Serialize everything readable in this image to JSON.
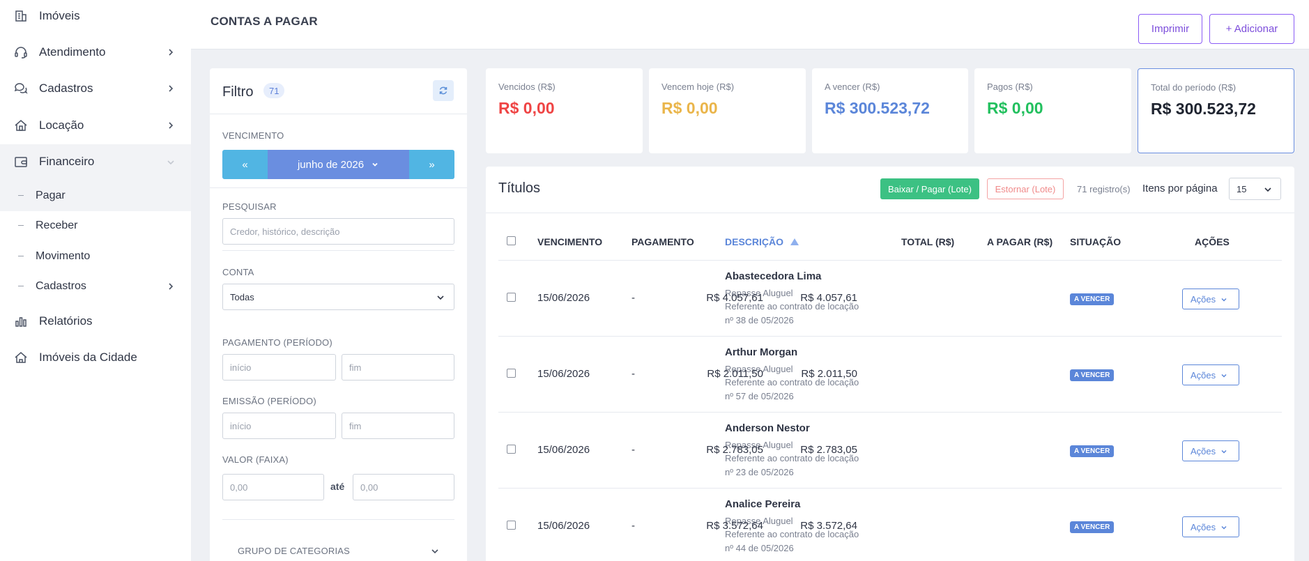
{
  "sidebar": {
    "items": [
      {
        "label": "Imóveis",
        "icon": "building-icon",
        "chevron": false
      },
      {
        "label": "Atendimento",
        "icon": "headset-icon",
        "chevron": true
      },
      {
        "label": "Cadastros",
        "icon": "chat-icon",
        "chevron": true
      },
      {
        "label": "Locação",
        "icon": "house-icon",
        "chevron": true
      },
      {
        "label": "Financeiro",
        "icon": "wallet-icon",
        "chevron": true,
        "expanded": true
      }
    ],
    "sub_items": [
      {
        "label": "Pagar",
        "active": true
      },
      {
        "label": "Receber"
      },
      {
        "label": "Movimento"
      },
      {
        "label": "Cadastros",
        "chevron": true
      }
    ],
    "bottom_items": [
      {
        "label": "Relatórios",
        "icon": "bar-chart-icon"
      },
      {
        "label": "Imóveis da Cidade",
        "icon": "house-outline-icon"
      }
    ]
  },
  "header": {
    "title": "CONTAS A PAGAR",
    "print_label": "Imprimir",
    "add_label": "+ Adicionar"
  },
  "filter": {
    "title": "Filtro",
    "count": "71",
    "vencimento_label": "VENCIMENTO",
    "prev_label": "«",
    "month_label": "junho de 2026",
    "next_label": "»",
    "search_label": "PESQUISAR",
    "search_placeholder": "Credor, histórico, descrição",
    "conta_label": "CONTA",
    "conta_value": "Todas",
    "pagamento_label": "PAGAMENTO (PERÍODO)",
    "emissao_label": "EMISSÃO (PERÍODO)",
    "inicio_placeholder": "início",
    "fim_placeholder": "fim",
    "valor_label": "VALOR (FAIXA)",
    "valor_min": "0,00",
    "valor_max": "0,00",
    "ate_label": "até",
    "grupo_label": "GRUPO DE CATEGORIAS"
  },
  "stats": [
    {
      "label": "Vencidos (R$)",
      "value": "R$ 0,00",
      "color": "#ef4444"
    },
    {
      "label": "Vencem hoje (R$)",
      "value": "R$ 0,00",
      "color": "#eab54a"
    },
    {
      "label": "A vencer (R$)",
      "value": "R$ 300.523,72",
      "color": "#5b86d9"
    },
    {
      "label": "Pagos (R$)",
      "value": "R$ 0,00",
      "color": "#22c05e"
    },
    {
      "label": "Total do período (R$)",
      "value": "R$ 300.523,72",
      "color": "#1f2430"
    }
  ],
  "titles": {
    "heading": "Títulos",
    "batch_pay_label": "Baixar / Pagar (Lote)",
    "batch_reverse_label": "Estornar (Lote)",
    "records_label": "71 registro(s)",
    "per_page_label": "Itens por página",
    "per_page_value": "15",
    "columns": {
      "vencimento": "VENCIMENTO",
      "pagamento": "PAGAMENTO",
      "descricao": "DESCRIÇÃO",
      "total": "TOTAL (R$)",
      "a_pagar": "A PAGAR (R$)",
      "situacao": "SITUAÇÃO",
      "acoes": "AÇÕES"
    },
    "rows": [
      {
        "vencimento": "15/06/2026",
        "pagamento": "-",
        "name": "Abastecedora Lima",
        "line1": "Repasse Aluguel",
        "line2": "Referente ao contrato de locação",
        "line3": "nº 38 de 05/2026",
        "total": "R$ 4.057,61",
        "a_pagar": "R$ 4.057,61",
        "status": "A VENCER",
        "acoes": "Ações"
      },
      {
        "vencimento": "15/06/2026",
        "pagamento": "-",
        "name": "Arthur Morgan",
        "line1": "Repasse Aluguel",
        "line2": "Referente ao contrato de locação",
        "line3": "nº 57 de 05/2026",
        "total": "R$ 2.011,50",
        "a_pagar": "R$ 2.011,50",
        "status": "A VENCER",
        "acoes": "Ações"
      },
      {
        "vencimento": "15/06/2026",
        "pagamento": "-",
        "name": "Anderson Nestor",
        "line1": "Repasse Aluguel",
        "line2": "Referente ao contrato de locação",
        "line3": "nº 23 de 05/2026",
        "total": "R$ 2.783,05",
        "a_pagar": "R$ 2.783,05",
        "status": "A VENCER",
        "acoes": "Ações"
      },
      {
        "vencimento": "15/06/2026",
        "pagamento": "-",
        "name": "Analice Pereira",
        "line1": "Repasse Aluguel",
        "line2": "Referente ao contrato de locação",
        "line3": "nº 44 de 05/2026",
        "total": "R$ 3.572,64",
        "a_pagar": "R$ 3.572,64",
        "status": "A VENCER",
        "acoes": "Ações"
      }
    ]
  }
}
